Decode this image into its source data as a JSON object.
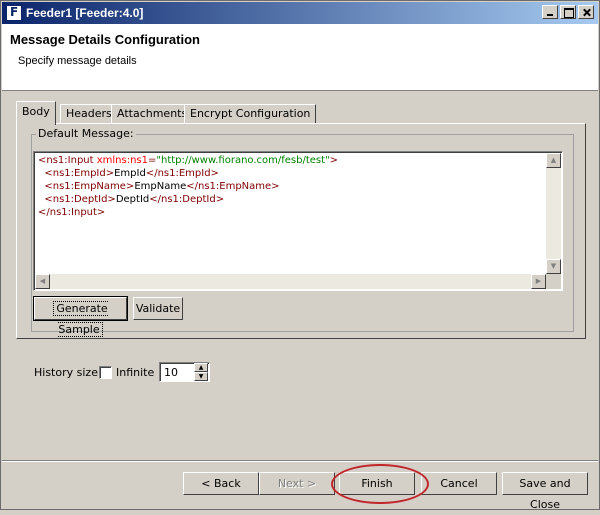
{
  "window": {
    "title": "Feeder1 [Feeder:4.0]"
  },
  "header": {
    "title": "Message Details Configuration",
    "subtitle": "Specify message details"
  },
  "tabs": [
    {
      "label": "Body",
      "active": true
    },
    {
      "label": "Headers",
      "active": false
    },
    {
      "label": "Attachments",
      "active": false
    },
    {
      "label": "Encrypt Configuration",
      "active": false
    }
  ],
  "body_tab": {
    "group_label": "Default Message:",
    "xml_lines": [
      {
        "t1": "<ns1:Input ",
        "attr": "xmlns:ns1",
        "eq": "=",
        "val": "\"http://www.fiorano.com/fesb/test\"",
        "t2": ">"
      },
      {
        "indent": "  ",
        "t1": "<ns1:EmpId>",
        "text": "EmpId",
        "t2": "</ns1:EmpId>"
      },
      {
        "indent": "  ",
        "t1": "<ns1:EmpName>",
        "text": "EmpName",
        "t2": "</ns1:EmpName>"
      },
      {
        "indent": "  ",
        "t1": "<ns1:DeptId>",
        "text": "DeptId",
        "t2": "</ns1:DeptId>"
      },
      {
        "t1": "</ns1:Input>"
      }
    ],
    "generate_sample_label": "Generate Sample",
    "validate_label": "Validate"
  },
  "history": {
    "label": "History size:",
    "infinite_label": "Infinite",
    "infinite_checked": false,
    "value": "10"
  },
  "footer": {
    "back_label": "< Back",
    "next_label": "Next >",
    "finish_label": "Finish",
    "cancel_label": "Cancel",
    "save_close_label": "Save and Close"
  },
  "colors": {
    "tag": "#800000",
    "attribute": "#ff0000",
    "value": "#008000",
    "annotation": "#c0262a"
  }
}
